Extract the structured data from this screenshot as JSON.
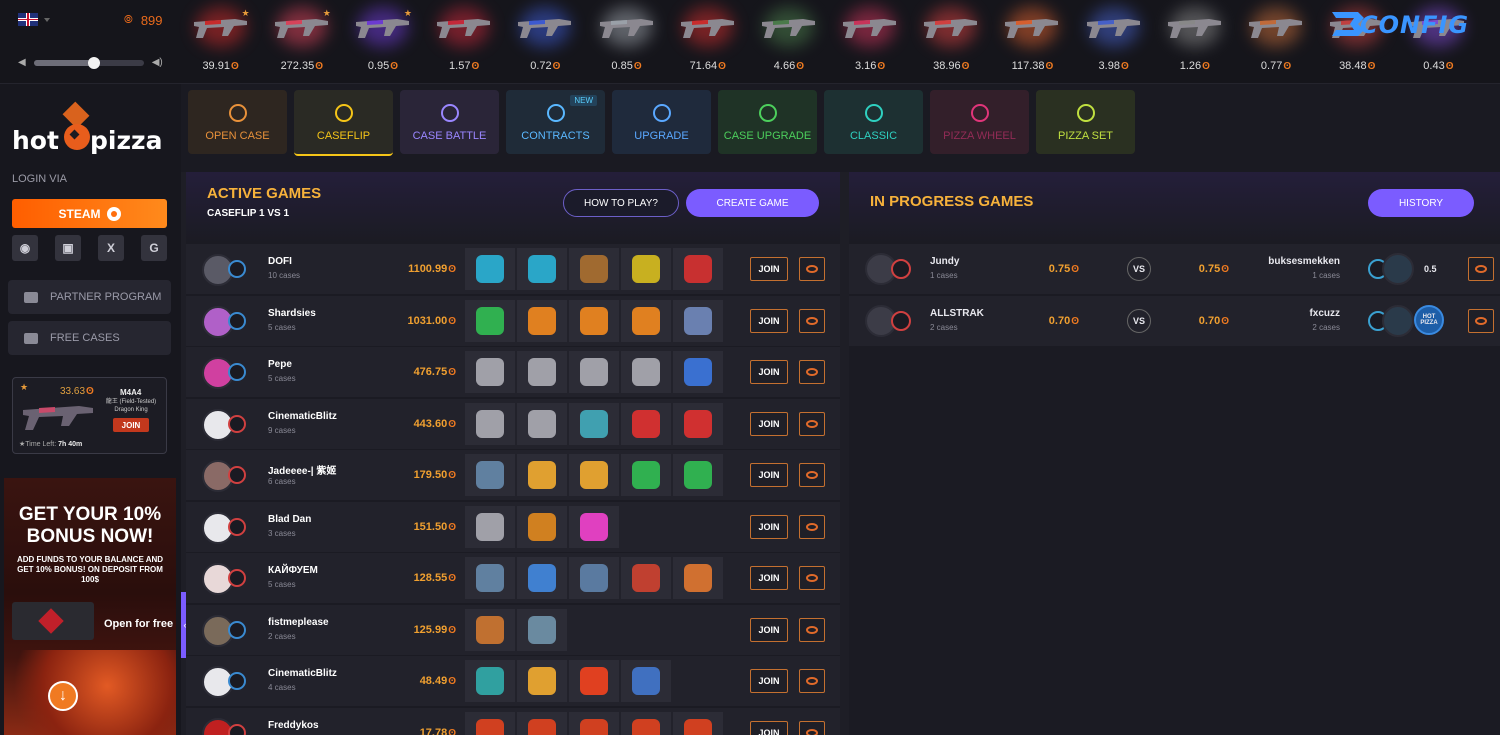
{
  "header": {
    "online_count": "899",
    "volume_level": 0.55,
    "drops": [
      {
        "price": "39.91",
        "color": "#c72b2b",
        "starred": true
      },
      {
        "price": "272.35",
        "color": "#d6435a",
        "starred": true
      },
      {
        "price": "0.95",
        "color": "#6c3bd1",
        "starred": true
      },
      {
        "price": "1.57",
        "color": "#c4283a",
        "starred": false
      },
      {
        "price": "0.72",
        "color": "#3d5ad0",
        "starred": false
      },
      {
        "price": "0.85",
        "color": "#9aa0a8",
        "starred": false
      },
      {
        "price": "71.64",
        "color": "#c82d2d",
        "starred": false
      },
      {
        "price": "4.66",
        "color": "#4a7a4a",
        "starred": false
      },
      {
        "price": "3.16",
        "color": "#c8345a",
        "starred": false
      },
      {
        "price": "38.96",
        "color": "#d04040",
        "starred": false
      },
      {
        "price": "117.38",
        "color": "#d65f2f",
        "starred": false
      },
      {
        "price": "3.98",
        "color": "#4660c8",
        "starred": false
      },
      {
        "price": "1.26",
        "color": "#888888",
        "starred": false
      },
      {
        "price": "0.77",
        "color": "#c06a3a",
        "starred": false
      },
      {
        "price": "38.48",
        "color": "#c04040",
        "starred": false
      },
      {
        "price": "0.43",
        "color": "#7d4ad0",
        "starred": false
      }
    ],
    "brand_logo": "CONFIG"
  },
  "sidebar": {
    "logo_left": "hot",
    "logo_right": "pizza",
    "login_via": "LOGIN VIA",
    "steam_label": "STEAM",
    "socials": [
      {
        "icon": "discord-icon",
        "glyph": "◉"
      },
      {
        "icon": "twitch-icon",
        "glyph": "▣"
      },
      {
        "icon": "x-icon",
        "glyph": "X"
      },
      {
        "icon": "google-icon",
        "glyph": "G"
      }
    ],
    "partner_label": "PARTNER PROGRAM",
    "free_cases_label": "FREE CASES",
    "giveaway": {
      "price": "33.63",
      "weapon": "M4A4",
      "skin": "龍王 (Field-Tested) Dragon King",
      "join_label": "JOIN",
      "time_label": "Time Left:",
      "time_value": "7h 40m"
    },
    "promo": {
      "title": "GET YOUR 10% BONUS NOW!",
      "subtitle": "ADD FUNDS TO YOUR BALANCE AND GET 10% BONUS! ON DEPOSIT FROM 100$",
      "open_label": "Open for free"
    }
  },
  "nav": {
    "items": [
      {
        "label": "OPEN CASE",
        "color": "#e8913a",
        "bg": "#2e2620"
      },
      {
        "label": "CASEFLIP",
        "color": "#f5c518",
        "bg": "#2a2a2a",
        "active": true
      },
      {
        "label": "CASE BATTLE",
        "color": "#9a86ff",
        "bg": "#2a2538"
      },
      {
        "label": "CONTRACTS",
        "color": "#5ab8ff",
        "bg": "#1f2b38",
        "badge": "NEW"
      },
      {
        "label": "UPGRADE",
        "color": "#5aa8ff",
        "bg": "#1f2a3c"
      },
      {
        "label": "CASE UPGRADE",
        "color": "#4ccf5c",
        "bg": "#1f3326"
      },
      {
        "label": "CLASSIC",
        "color": "#2fd0c0",
        "bg": "#1d3032"
      },
      {
        "label": "PIZZA WHEEL",
        "color": "#e0357a",
        "bg": "#331f2a"
      },
      {
        "label": "PIZZA SET",
        "color": "#c0e040",
        "bg": "#2a3021"
      }
    ]
  },
  "active": {
    "title": "ACTIVE GAMES",
    "subtitle": "CASEFLIP 1 VS 1",
    "how_to_play": "HOW TO PLAY?",
    "create_game": "CREATE GAME",
    "join_label": "JOIN",
    "games": [
      {
        "name": "DOFI",
        "cases": "10 cases",
        "amount": "1100.99",
        "avatar": "#5a5a66",
        "ring": "#3a8ad0",
        "items": [
          "#2aa6c8",
          "#2aa6c8",
          "#a06a30",
          "#c8b020",
          "#c83030"
        ]
      },
      {
        "name": "Shardsies",
        "cases": "5 cases",
        "amount": "1031.00",
        "avatar": "#b060c8",
        "ring": "#3a8ad0",
        "items": [
          "#30b050",
          "#e08020",
          "#e08020",
          "#e08020",
          "#6a80b0"
        ]
      },
      {
        "name": "Pepe",
        "cases": "5 cases",
        "amount": "476.75",
        "avatar": "#d040a0",
        "ring": "#3a8ad0",
        "items": [
          "#a0a0a8",
          "#a0a0a8",
          "#a0a0a8",
          "#a0a0a8",
          "#3a70d0"
        ]
      },
      {
        "name": "CinematicBlitz",
        "cases": "9 cases",
        "amount": "443.60",
        "avatar": "#e8e8ec",
        "ring": "#d04040",
        "items": [
          "#a0a0a8",
          "#a0a0a8",
          "#40a0b0",
          "#d03030",
          "#d03030"
        ]
      },
      {
        "name": "Jadeeee-| 紫姬",
        "cases": "6 cases",
        "amount": "179.50",
        "avatar": "#8a6a66",
        "ring": "#d04040",
        "items": [
          "#6080a0",
          "#e0a030",
          "#e0a030",
          "#30b050",
          "#30b050"
        ]
      },
      {
        "name": "Blad Dan",
        "cases": "3 cases",
        "amount": "151.50",
        "avatar": "#e8e8ec",
        "ring": "#d04040",
        "items": [
          "#a0a0a8",
          "#d08020",
          "#e040c0"
        ]
      },
      {
        "name": "КАЙФУЕМ",
        "cases": "5 cases",
        "amount": "128.55",
        "avatar": "#e8d8d8",
        "ring": "#d04040",
        "items": [
          "#6080a0",
          "#4080d0",
          "#5a7aa0",
          "#c04030",
          "#d07030"
        ]
      },
      {
        "name": "fistmeplease",
        "cases": "2 cases",
        "amount": "125.99",
        "avatar": "#7a6a5a",
        "ring": "#3a8ad0",
        "items": [
          "#c07030",
          "#6a8aa0"
        ]
      },
      {
        "name": "CinematicBlitz",
        "cases": "4 cases",
        "amount": "48.49",
        "avatar": "#e8e8ec",
        "ring": "#3a8ad0",
        "items": [
          "#30a0a0",
          "#e0a030",
          "#e04020",
          "#4070c0"
        ]
      },
      {
        "name": "Freddykos",
        "cases": "",
        "amount": "17.78",
        "avatar": "#c02020",
        "ring": "#d04040",
        "items": [
          "#d04020",
          "#d04020",
          "#d04020",
          "#d04020",
          "#d04020"
        ]
      }
    ]
  },
  "progress": {
    "title": "IN PROGRESS GAMES",
    "history": "HISTORY",
    "vs_label": "VS",
    "games": [
      {
        "name": "Jundy",
        "cases": "1 cases",
        "amount1": "0.75",
        "amount2": "0.75",
        "opponent": "buksesmekken",
        "opp_cases": "1 cases",
        "score": "0.5",
        "mini": ""
      },
      {
        "name": "ALLSTRAK",
        "cases": "2 cases",
        "amount1": "0.70",
        "amount2": "0.70",
        "opponent": "fxcuzz",
        "opp_cases": "2 cases",
        "score": "",
        "mini": "HOT PIZZA"
      }
    ]
  }
}
